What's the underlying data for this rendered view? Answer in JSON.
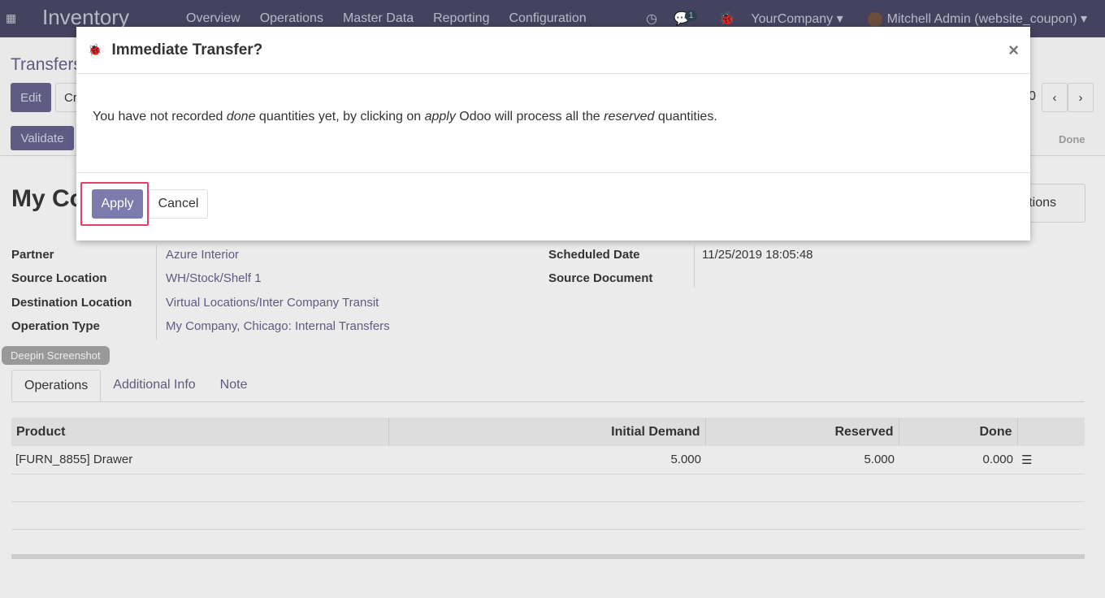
{
  "navbar": {
    "app_title": "Inventory",
    "menu": [
      "Overview",
      "Operations",
      "Master Data",
      "Reporting",
      "Configuration"
    ],
    "message_count": "1",
    "company": "YourCompany",
    "user": "Mitchell Admin (website_coupon)"
  },
  "breadcrumb": "Transfers",
  "control": {
    "edit": "Edit",
    "create": "Cr",
    "pager_partial": "0",
    "validate": "Validate",
    "status_done": "Done"
  },
  "record": {
    "title_partial": "My Co",
    "smart_button_partial": "tions",
    "fields": {
      "partner_label": "Partner",
      "partner": "Azure Interior",
      "source_location_label": "Source Location",
      "source_location": "WH/Stock/Shelf 1",
      "destination_location_label": "Destination Location",
      "destination_location": "Virtual Locations/Inter Company Transit",
      "operation_type_label": "Operation Type",
      "operation_type": "My Company, Chicago: Internal Transfers",
      "scheduled_date_label": "Scheduled Date",
      "scheduled_date": "11/25/2019 18:05:48",
      "source_document_label": "Source Document"
    }
  },
  "screenshot_tag": "Deepin Screenshot",
  "tabs": [
    "Operations",
    "Additional Info",
    "Note"
  ],
  "table": {
    "headers": [
      "Product",
      "Initial Demand",
      "Reserved",
      "Done"
    ],
    "rows": [
      {
        "product": "[FURN_8855] Drawer",
        "initial_demand": "5.000",
        "reserved": "5.000",
        "done": "0.000"
      }
    ]
  },
  "modal": {
    "title": "Immediate Transfer?",
    "message_parts": [
      "You have not recorded ",
      "done",
      " quantities yet, by clicking on ",
      "apply",
      " Odoo will process all the ",
      "reserved",
      " quantities."
    ],
    "apply": "Apply",
    "cancel": "Cancel",
    "close": "×"
  }
}
